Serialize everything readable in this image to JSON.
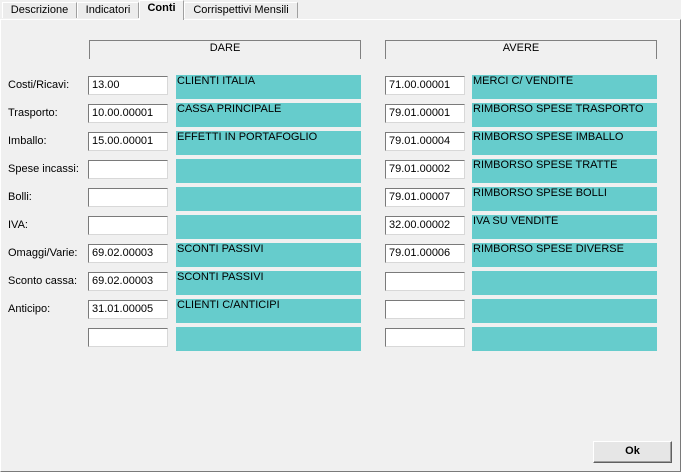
{
  "tabs": [
    {
      "label": "Descrizione"
    },
    {
      "label": "Indicatori"
    },
    {
      "label": "Conti"
    },
    {
      "label": "Corrispettivi Mensili"
    }
  ],
  "headers": {
    "dare": "DARE",
    "avere": "AVERE"
  },
  "rows": [
    {
      "label": "Costi/Ricavi:",
      "dare_code": "13.00",
      "dare_desc": "CLIENTI ITALIA",
      "avere_code": "71.00.00001",
      "avere_desc": "MERCI C/ VENDITE"
    },
    {
      "label": "Trasporto:",
      "dare_code": "10.00.00001",
      "dare_desc": "CASSA PRINCIPALE",
      "avere_code": "79.01.00001",
      "avere_desc": "RIMBORSO SPESE TRASPORTO"
    },
    {
      "label": "Imballo:",
      "dare_code": "15.00.00001",
      "dare_desc": "EFFETTI IN PORTAFOGLIO",
      "avere_code": "79.01.00004",
      "avere_desc": "RIMBORSO SPESE IMBALLO"
    },
    {
      "label": "Spese incassi:",
      "dare_code": "",
      "dare_desc": "",
      "avere_code": "79.01.00002",
      "avere_desc": "RIMBORSO SPESE TRATTE"
    },
    {
      "label": "Bolli:",
      "dare_code": "",
      "dare_desc": "",
      "avere_code": "79.01.00007",
      "avere_desc": "RIMBORSO SPESE BOLLI"
    },
    {
      "label": "IVA:",
      "dare_code": "",
      "dare_desc": "",
      "avere_code": "32.00.00002",
      "avere_desc": "IVA SU VENDITE"
    },
    {
      "label": "Omaggi/Varie:",
      "dare_code": "69.02.00003",
      "dare_desc": "SCONTI PASSIVI",
      "avere_code": "79.01.00006",
      "avere_desc": "RIMBORSO SPESE DIVERSE"
    },
    {
      "label": "Sconto cassa:",
      "dare_code": "69.02.00003",
      "dare_desc": "SCONTI PASSIVI",
      "avere_code": "",
      "avere_desc": ""
    },
    {
      "label": "Anticipo:",
      "dare_code": "31.01.00005",
      "dare_desc": "CLIENTI C/ANTICIPI",
      "avere_code": "",
      "avere_desc": ""
    },
    {
      "label": "",
      "dare_code": "",
      "dare_desc": "",
      "avere_code": "",
      "avere_desc": ""
    }
  ],
  "ok_button": "Ok"
}
